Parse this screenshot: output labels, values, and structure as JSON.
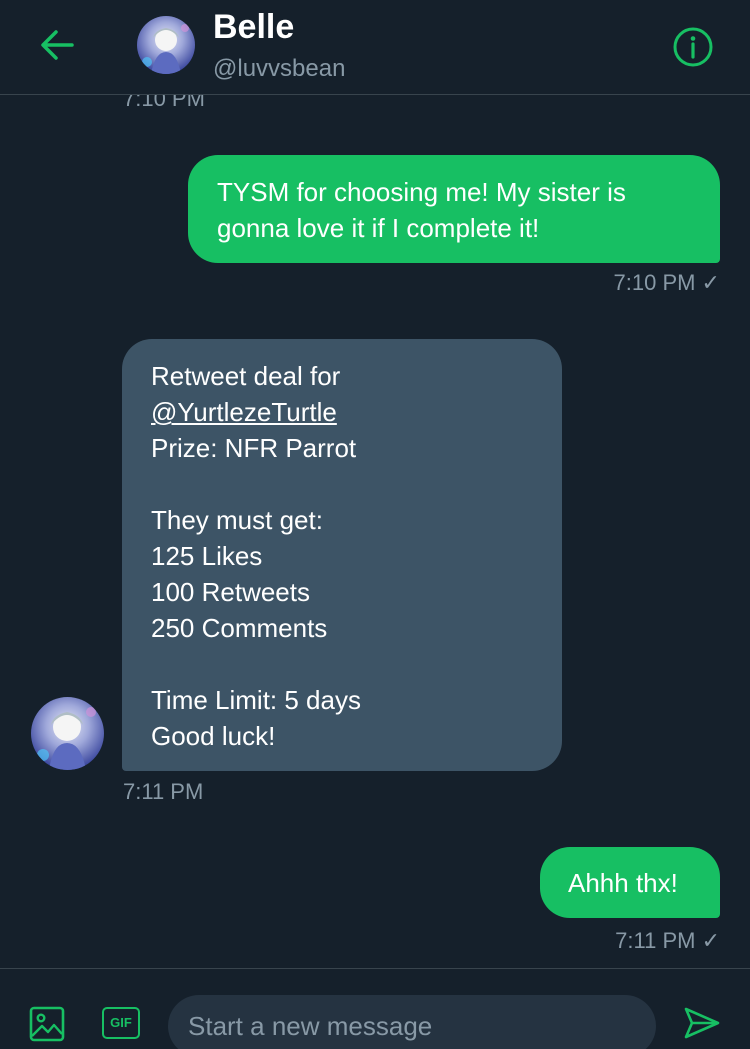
{
  "header": {
    "title": "Belle",
    "handle": "@luvvsbean",
    "back_icon": "arrow-left-icon",
    "info_icon": "info-icon",
    "accent_color": "#17bf63"
  },
  "messages": [
    {
      "direction": "in",
      "time": "7:10 PM"
    },
    {
      "direction": "out",
      "text_lines": [
        "TYSM for choosing me! My sister is",
        "gonna love it if I complete it!"
      ],
      "time": "7:10 PM ✓"
    },
    {
      "direction": "in",
      "text_lines": [
        "Retweet deal for",
        "@YurtlezeTurtle",
        "Prize: NFR Parrot",
        "",
        "They must get:",
        "125 Likes",
        "100 Retweets",
        "250 Comments",
        "",
        "Time Limit: 5 days",
        "Good luck!"
      ],
      "time": "7:11 PM"
    },
    {
      "direction": "out",
      "text_lines": [
        "Ahhh thx!"
      ],
      "time": "7:11 PM ✓"
    }
  ],
  "composer": {
    "placeholder": "Start a new message",
    "gif_label": "GIF",
    "media_icon": "image-icon",
    "send_icon": "send-icon"
  },
  "colors": {
    "background": "#15202b",
    "outgoing_bubble": "#17bf63",
    "incoming_bubble": "#3d5466",
    "secondary_text": "#8899a6"
  }
}
